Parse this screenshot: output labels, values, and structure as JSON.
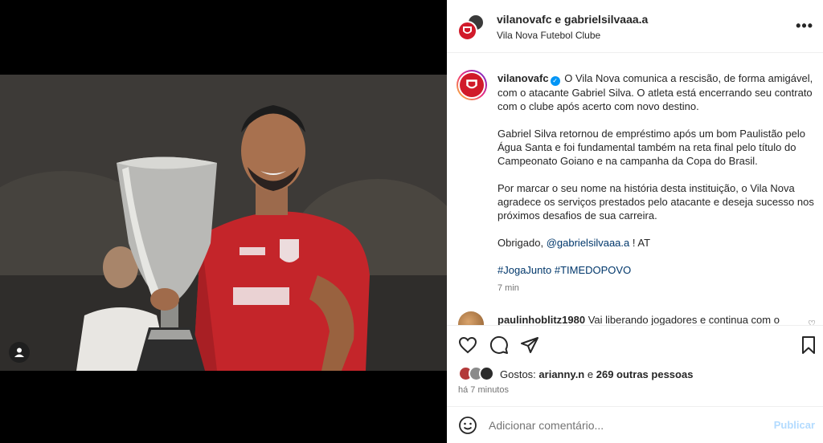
{
  "header": {
    "title": "vilanovafc e gabrielsilvaaa.a",
    "subtitle": "Vila Nova Futebol Clube",
    "more_label": "•••"
  },
  "caption": {
    "username": "vilanovafc",
    "verified_icon": "verified-badge-icon",
    "paragraph1": "O Vila Nova comunica a rescisão, de forma amigável, com o atacante Gabriel Silva. O atleta está encerrando seu contrato com o clube após acerto com novo destino.",
    "paragraph2": "Gabriel Silva retornou de empréstimo após um bom Paulistão pelo Água Santa e foi fundamental também na reta final pelo título do Campeonato Goiano e na campanha da Copa do Brasil.",
    "paragraph3": "Por marcar o seu nome na história desta instituição, o Vila Nova agradece os serviços prestados pelo atacante e deseja sucesso nos próximos desafios de sua carreira.",
    "thanks": "Obrigado,",
    "mention": "@gabrielsilvaaa.a",
    "signature": "! AT",
    "hashtags": "#JogaJunto #TIMEDOPOVO",
    "time": "7 min"
  },
  "comment": {
    "username": "paulinhoblitz1980",
    "text": "Vai liberando jogadores e continua com o"
  },
  "likes": {
    "prefix": "Gostos:",
    "user": "arianny.n",
    "connector": "e",
    "others": "269 outras pessoas"
  },
  "posted": "há 7 minutos",
  "add_comment": {
    "placeholder": "Adicionar comentário...",
    "publish_label": "Publicar"
  },
  "icons": [
    "user-tag-icon",
    "heart-icon",
    "comment-icon",
    "share-icon",
    "save-icon",
    "emoji-icon"
  ],
  "colors": {
    "accent": "#0095f6",
    "brand_red": "#d11a2a",
    "link": "#00376b",
    "publish_disabled": "#b3dbff"
  }
}
